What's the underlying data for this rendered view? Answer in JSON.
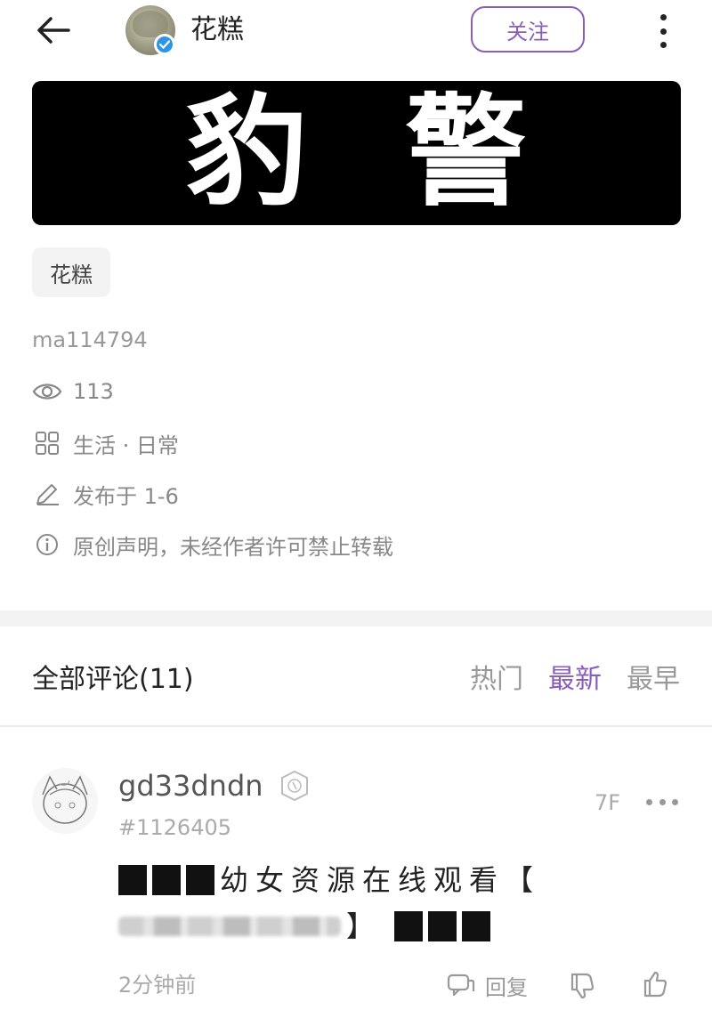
{
  "header": {
    "author_name": "花糕",
    "follow_label": "关注",
    "icons": {
      "back": "arrow-left-icon",
      "verified": "verified-check-icon",
      "more": "more-vertical-icon"
    }
  },
  "banner": {
    "text_left": "豹",
    "text_right": "警"
  },
  "post": {
    "tag": "花糕",
    "id_text": "ma114794",
    "views": "113",
    "category": "生活 · 日常",
    "published": "发布于 1-6",
    "copyright_notice": "原创声明，未经作者许可禁止转载"
  },
  "comments": {
    "title": "全部评论",
    "count": "(11)",
    "sort_tabs": [
      {
        "label": "热门",
        "active": false
      },
      {
        "label": "最新",
        "active": true
      },
      {
        "label": "最早",
        "active": false
      }
    ],
    "items": [
      {
        "username": "gd33dndn",
        "uid": "#1126405",
        "floor": "7F",
        "text_line1": "幼女资源在线观看【",
        "text_line2_bracket": "】",
        "time": "2分钟前",
        "reply_label": "回复"
      }
    ]
  },
  "colors": {
    "accent": "#8a5db8",
    "verified": "#2d95e6",
    "muted_text": "#999999",
    "divider": "#f3f3f3"
  }
}
